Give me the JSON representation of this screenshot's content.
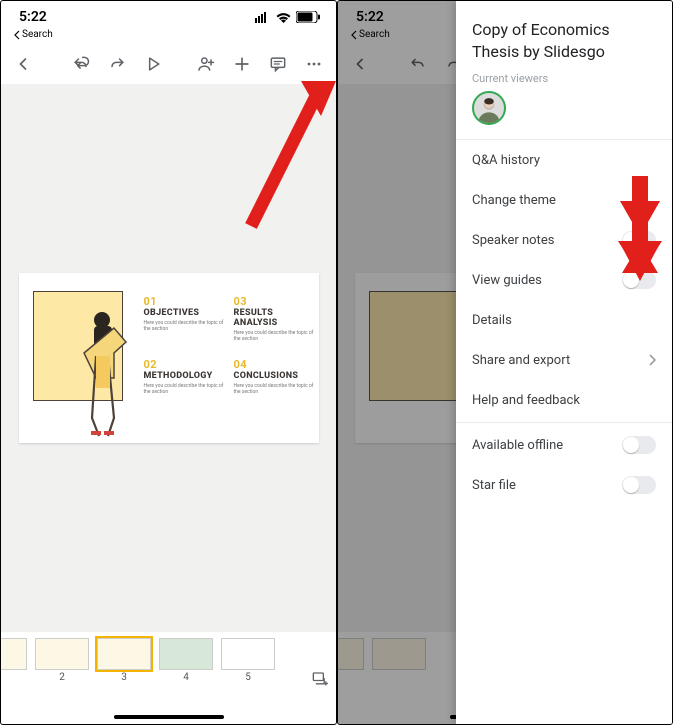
{
  "status": {
    "time": "5:22",
    "back_label": "Search"
  },
  "toolbar_icons": [
    "back",
    "undo",
    "redo",
    "play",
    "share-user",
    "plus",
    "comment",
    "more"
  ],
  "slide": {
    "blocks": [
      {
        "num": "01",
        "title": "OBJECTIVES",
        "desc": "Here you could describe the topic of the section"
      },
      {
        "num": "02",
        "title": "METHODOLOGY",
        "desc": "Here you could describe the topic of the section"
      },
      {
        "num": "03",
        "title": "RESULTS ANALYSIS",
        "desc": "Here you could describe the topic of the section"
      },
      {
        "num": "04",
        "title": "CONCLUSIONS",
        "desc": "Here you could describe the topic of the section"
      }
    ]
  },
  "thumbs": [
    {
      "n": "2",
      "sel": false
    },
    {
      "n": "3",
      "sel": true
    },
    {
      "n": "4",
      "sel": false
    },
    {
      "n": "5",
      "sel": false
    }
  ],
  "sheet": {
    "title": "Copy of Economics Thesis by Slidesgo",
    "current_viewers_label": "Current viewers",
    "items": [
      {
        "label": "Q&A history",
        "type": "plain"
      },
      {
        "label": "Change theme",
        "type": "plain"
      },
      {
        "label": "Speaker notes",
        "type": "toggle"
      },
      {
        "label": "View guides",
        "type": "toggle"
      },
      {
        "label": "Details",
        "type": "plain"
      },
      {
        "label": "Share and export",
        "type": "chevron"
      },
      {
        "label": "Help and feedback",
        "type": "plain"
      },
      {
        "label": "Available offline",
        "type": "toggle",
        "group": "b"
      },
      {
        "label": "Star file",
        "type": "toggle",
        "group": "b"
      }
    ]
  }
}
